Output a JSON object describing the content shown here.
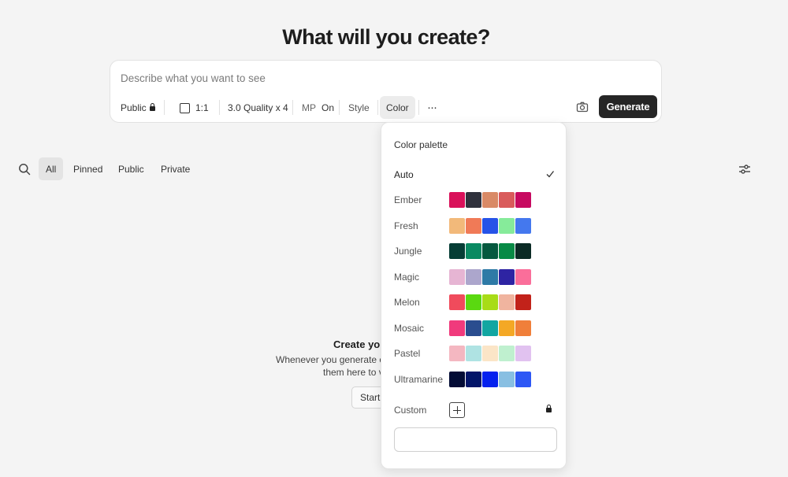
{
  "heading": "What will you create?",
  "prompt": {
    "placeholder": "Describe what you want to see",
    "value": ""
  },
  "toolbar": {
    "visibility_label": "Public",
    "aspect_label": "1:1",
    "quality_label": "3.0 Quality x 4",
    "mp_label": "MP",
    "mp_value": "On",
    "style_label": "Style",
    "color_label": "Color",
    "more_label": "···",
    "generate_label": "Generate"
  },
  "filters": {
    "tabs": [
      {
        "label": "All",
        "active": true
      },
      {
        "label": "Pinned",
        "active": false
      },
      {
        "label": "Public",
        "active": false
      },
      {
        "label": "Private",
        "active": false
      }
    ]
  },
  "empty_state": {
    "title": "Create you",
    "line1": "Whenever you generate o",
    "line2": "them here to v",
    "button": "Start"
  },
  "color_menu": {
    "title": "Color palette",
    "auto_label": "Auto",
    "selected": "Auto",
    "palettes": [
      {
        "name": "Ember",
        "colors": [
          "#d9115a",
          "#30323d",
          "#d98a66",
          "#d95b5b",
          "#c70a60"
        ]
      },
      {
        "name": "Fresh",
        "colors": [
          "#f2b97a",
          "#f07a57",
          "#2653e8",
          "#86eb9a",
          "#4478ee"
        ]
      },
      {
        "name": "Jungle",
        "colors": [
          "#063d35",
          "#0a8a62",
          "#05593f",
          "#078a45",
          "#0b2b25"
        ]
      },
      {
        "name": "Magic",
        "colors": [
          "#e6b5d3",
          "#aca6cc",
          "#2e7aa6",
          "#2e24a3",
          "#fa6e9a"
        ]
      },
      {
        "name": "Melon",
        "colors": [
          "#f04b5c",
          "#5ad910",
          "#a8dc17",
          "#f0b49f",
          "#c2221a"
        ]
      },
      {
        "name": "Mosaic",
        "colors": [
          "#f03a7c",
          "#2a4d8f",
          "#12a6a1",
          "#f4a825",
          "#f07f3a"
        ]
      },
      {
        "name": "Pastel",
        "colors": [
          "#f4b7c1",
          "#afe3e3",
          "#fbe5c7",
          "#bff0cf",
          "#e1c2f0"
        ]
      },
      {
        "name": "Ultramarine",
        "colors": [
          "#030c35",
          "#021569",
          "#0521ee",
          "#88bfe2",
          "#2d57f5"
        ]
      }
    ],
    "custom_label": "Custom",
    "custom_value": ""
  }
}
